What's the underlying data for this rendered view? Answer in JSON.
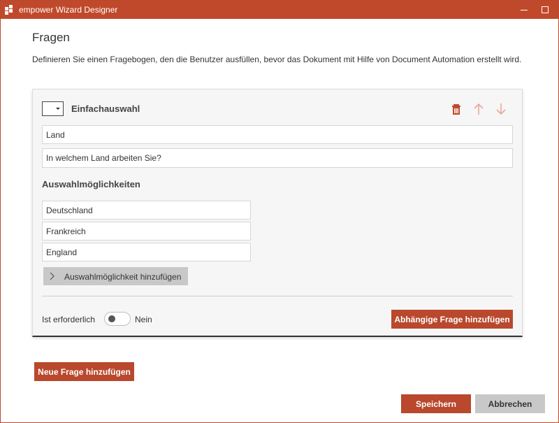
{
  "window": {
    "title": "empower Wizard Designer",
    "accent_color": "#c0492b"
  },
  "page": {
    "title": "Fragen",
    "description": "Definieren Sie einen Fragebogen, den die Benutzer ausfüllen, bevor das Dokument mit Hilfe von Document Automation erstellt wird."
  },
  "question": {
    "type_label": "Einfachauswahl",
    "name_value": "Land",
    "question_value": "In welchem Land arbeiten Sie?",
    "options_heading": "Auswahlmöglichkeiten",
    "options": [
      "Deutschland",
      "Frankreich",
      "England"
    ],
    "add_option_label": "Auswahlmöglichkeit hinzufügen",
    "required_label": "Ist erforderlich",
    "required_state": "Nein",
    "required_on": false,
    "add_dependent_label": "Abhängige Frage hinzufügen",
    "icons": [
      "trash-icon",
      "arrow-up-icon",
      "arrow-down-icon",
      "dropdown-icon"
    ]
  },
  "footer": {
    "new_question_label": "Neue Frage hinzufügen",
    "save_label": "Speichern",
    "cancel_label": "Abbrechen"
  }
}
